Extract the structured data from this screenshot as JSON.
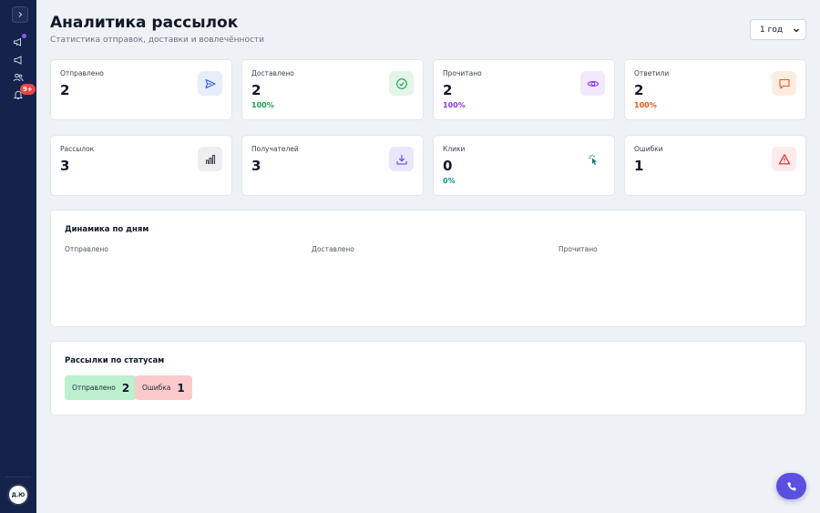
{
  "header": {
    "title": "Аналитика рассылок",
    "subtitle": "Статистика отправок, доставки и вовлечённости",
    "period_select": {
      "value": "1 год"
    }
  },
  "sidebar": {
    "notifications_badge": "9+",
    "user_initials": "Д.Ю"
  },
  "stats": [
    {
      "label": "Отправлено",
      "value": "2",
      "pct": "",
      "icon": "send-icon",
      "icon_bg": "#e6edfb",
      "icon_color": "#3b5bdb"
    },
    {
      "label": "Доставлено",
      "value": "2",
      "pct": "100%",
      "pct_color": "#16a34a",
      "icon": "check-circle-icon",
      "icon_bg": "#e3f5e9",
      "icon_color": "#16a34a"
    },
    {
      "label": "Прочитано",
      "value": "2",
      "pct": "100%",
      "pct_color": "#9333ea",
      "icon": "eye-icon",
      "icon_bg": "#f1e8fb",
      "icon_color": "#9333ea"
    },
    {
      "label": "Ответили",
      "value": "2",
      "pct": "100%",
      "pct_color": "#ea580c",
      "icon": "message-icon",
      "icon_bg": "#fdece2",
      "icon_color": "#ea580c"
    },
    {
      "label": "Рассылок",
      "value": "3",
      "pct": "",
      "icon": "bar-chart-icon",
      "icon_bg": "#eceef1",
      "icon_color": "#374151"
    },
    {
      "label": "Получателей",
      "value": "3",
      "pct": "",
      "icon": "download-icon",
      "icon_bg": "#e9e8fb",
      "icon_color": "#4f46e5"
    },
    {
      "label": "Клики",
      "value": "0",
      "pct": "0%",
      "pct_color": "#0d9488",
      "icon": "pointer-click-icon",
      "icon_bg": "#ffffff",
      "icon_color": "#0f766e"
    },
    {
      "label": "Ошибки",
      "value": "1",
      "pct": "",
      "icon": "alert-triangle-icon",
      "icon_bg": "#fdeaea",
      "icon_color": "#dc2626"
    }
  ],
  "daily_dynamics": {
    "title": "Динамика по дням",
    "legend": [
      "Отправлено",
      "Доставлено",
      "Прочитано"
    ]
  },
  "status_breakdown": {
    "title": "Рассылки по статусам",
    "items": [
      {
        "label": "Отправлено",
        "count": "2",
        "bg": "#bdf0cf"
      },
      {
        "label": "Ошибка",
        "count": "1",
        "bg": "#fbcaca"
      }
    ]
  },
  "colors": {
    "sidebar": "#15234a",
    "accent": "#5b4fe0",
    "background": "#eef1f6"
  }
}
